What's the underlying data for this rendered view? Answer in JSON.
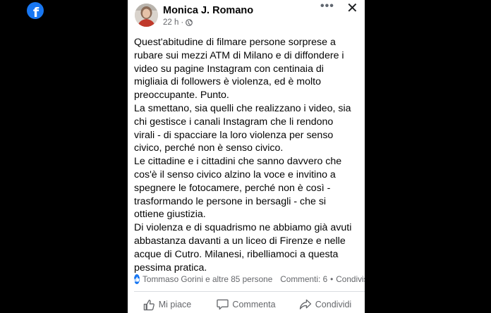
{
  "app": {
    "brand_icon": "facebook-icon",
    "brand_color": "#1877f2"
  },
  "post": {
    "author": "Monica J. Romano",
    "time": "22 h",
    "separator": "·",
    "privacy_icon": "globe-icon",
    "more_label": "•••",
    "close_label": "✕",
    "body_lines": [
      "Quest'abitudine di filmare persone sorprese a",
      "rubare sui mezzi ATM di Milano e di diffondere i",
      "video su pagine Instagram con centinaia di",
      "migliaia di followers è violenza, ed è molto",
      "preoccupante. Punto.",
      "La smettano, sia quelli che realizzano i video, sia",
      "chi gestisce i canali Instagram che li rendono",
      "virali - di spacciare la loro violenza per senso",
      "civico, perché non è senso civico.",
      "Le cittadine e i cittadini che sanno davvero che",
      "cos'è il senso civico alzino la voce e invitino a",
      "spegnere le fotocamere, perché non è così -",
      "trasformando le persone in bersagli - che si",
      "ottiene giustizia.",
      "Di violenza e di squadrismo ne abbiamo già avuti",
      "abbastanza davanti a un liceo di Firenze e nelle",
      "acque di Cutro. Milanesi, ribelliamoci a questa",
      "pessima pratica."
    ],
    "reactions_text": "Tommaso Gorini e altre 85 persone",
    "comments_text": "Commenti: 6",
    "bullet": "•",
    "shares_text": "Condivisioni",
    "actions": {
      "like": "Mi piace",
      "comment": "Commenta",
      "share": "Condividi"
    }
  }
}
